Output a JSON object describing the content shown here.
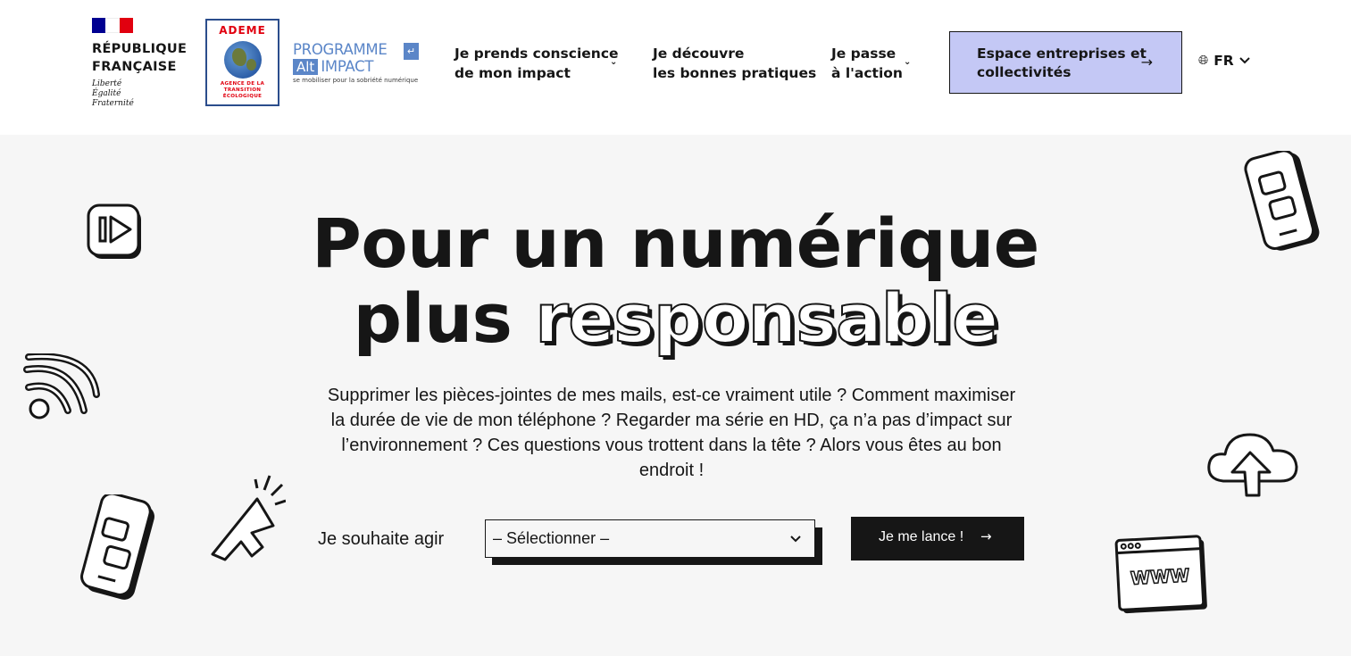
{
  "header": {
    "gov": {
      "title": "RÉPUBLIQUE\nFRANÇAISE",
      "motto": "Liberté\nÉgalité\nFraternité",
      "flag_colors": [
        "#000091",
        "#ffffff",
        "#e1000f"
      ]
    },
    "ademe": {
      "name": "ADEME",
      "subtitle": "AGENCE DE LA\nTRANSITION\nÉCOLOGIQUE"
    },
    "program": {
      "line1": "PROGRAMME",
      "alt": "Alt",
      "impact": "IMPACT",
      "tagline": "se mobiliser pour la sobriété numérique",
      "icon": "enter-arrow-icon"
    },
    "nav": [
      {
        "label": "Je prends conscience\nde mon impact",
        "has_dropdown": true
      },
      {
        "label": "Je découvre\nles bonnes pratiques",
        "has_dropdown": false
      },
      {
        "label": "Je passe\nà l'action",
        "has_dropdown": true
      }
    ],
    "cta": {
      "label": "Espace entreprises et\ncollectivités",
      "icon": "arrow-right-icon"
    },
    "language": {
      "code": "FR",
      "icon": "globe-icon"
    }
  },
  "hero": {
    "title_line1": "Pour un numérique",
    "title_line2_plain": "plus",
    "title_line2_outline": "responsable",
    "description": "Supprimer les pièces-jointes de mes mails, est-ce vraiment utile ? Comment maximiser la durée de vie de mon téléphone ? Regarder ma série en HD, ça n’a pas d’impact sur l’environnement ? Ces questions vous trottent dans la tête ? Alors vous êtes au bon endroit !",
    "action_label": "Je souhaite agir",
    "select_value": "– Sélectionner –",
    "submit_label": "Je me lance !",
    "decorations": [
      "play-video-icon",
      "wifi-icon",
      "smartphone-chat-icon",
      "cursor-click-icon",
      "smartphone-chat-icon",
      "cloud-upload-icon",
      "browser-www-icon"
    ]
  },
  "colors": {
    "accent": "#c4c8f5",
    "dark": "#161616",
    "hero_bg": "#f6f6f6",
    "program_blue": "#5b86c8"
  }
}
